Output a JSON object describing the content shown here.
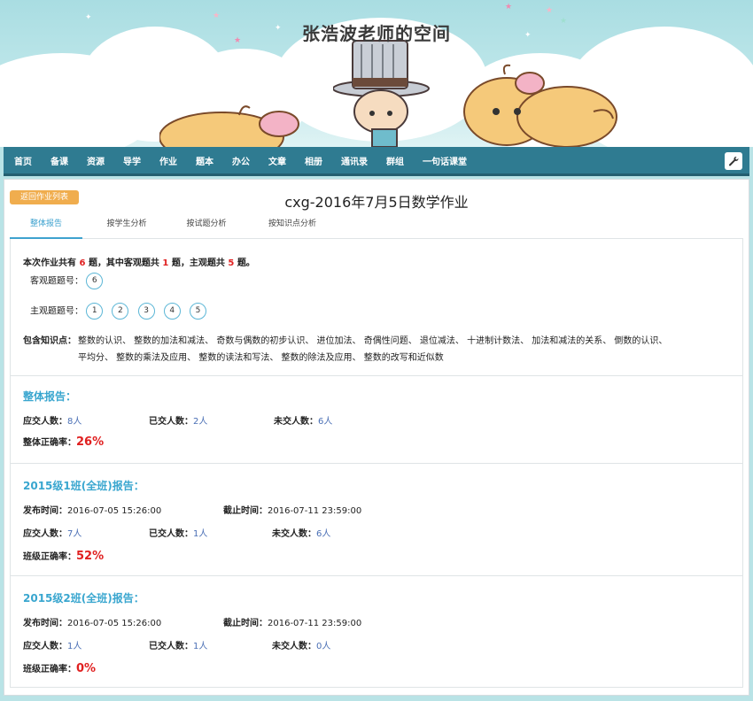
{
  "banner": {
    "title": "张浩波老师的空间"
  },
  "nav": {
    "items": [
      "首页",
      "备课",
      "资源",
      "导学",
      "作业",
      "题本",
      "办公",
      "文章",
      "相册",
      "通讯录",
      "群组",
      "一句话课堂"
    ]
  },
  "page": {
    "back_label": "返回作业列表",
    "title": "cxg-2016年7月5日数学作业",
    "tabs": [
      "整体报告",
      "按学生分析",
      "按试题分析",
      "按知识点分析"
    ],
    "active_tab": "整体报告"
  },
  "summary": {
    "prefix": "本次作业共有",
    "total": "6",
    "mid1": "题，其中客观题共",
    "objective_count": "1",
    "mid2": "题，主观题共",
    "subjective_count": "5",
    "suffix": "题。",
    "objective_label": "客观题题号：",
    "objective_numbers": [
      "6"
    ],
    "subjective_label": "主观题题号：",
    "subjective_numbers": [
      "1",
      "2",
      "3",
      "4",
      "5"
    ],
    "knowledge_label": "包含知识点：",
    "knowledge_line1": "整数的认识、 整数的加法和减法、 奇数与偶数的初步认识、 进位加法、 奇偶性问题、 退位减法、 十进制计数法、 加法和减法的关系、 倒数的认识、",
    "knowledge_line2": "平均分、 整数的乘法及应用、 整数的读法和写法、 整数的除法及应用、 整数的改写和近似数"
  },
  "overall": {
    "title": "整体报告：",
    "should_label": "应交人数：",
    "should_value": "8人",
    "submitted_label": "已交人数：",
    "submitted_value": "2人",
    "missing_label": "未交人数：",
    "missing_value": "6人",
    "accuracy_label": "整体正确率：",
    "accuracy_value": "26%"
  },
  "class1": {
    "title": "2015级1班(全班)报告：",
    "publish_label": "发布时间：",
    "publish_value": "2016-07-05 15:26:00",
    "deadline_label": "截止时间：",
    "deadline_value": "2016-07-11 23:59:00",
    "should_label": "应交人数：",
    "should_value": "7人",
    "submitted_label": "已交人数：",
    "submitted_value": "1人",
    "missing_label": "未交人数：",
    "missing_value": "6人",
    "accuracy_label": "班级正确率：",
    "accuracy_value": "52%"
  },
  "class2": {
    "title": "2015级2班(全班)报告：",
    "publish_label": "发布时间：",
    "publish_value": "2016-07-05 15:26:00",
    "deadline_label": "截止时间：",
    "deadline_value": "2016-07-11 23:59:00",
    "should_label": "应交人数：",
    "should_value": "1人",
    "submitted_label": "已交人数：",
    "submitted_value": "1人",
    "missing_label": "未交人数：",
    "missing_value": "0人",
    "accuracy_label": "班级正确率：",
    "accuracy_value": "0%"
  },
  "colors": {
    "nav_bg": "#2f7b91",
    "accent": "#39a6cf",
    "back_button": "#f0ad4e",
    "highlight_red": "#e02020"
  },
  "icons": {
    "nav_tool": "wrench-icon"
  }
}
